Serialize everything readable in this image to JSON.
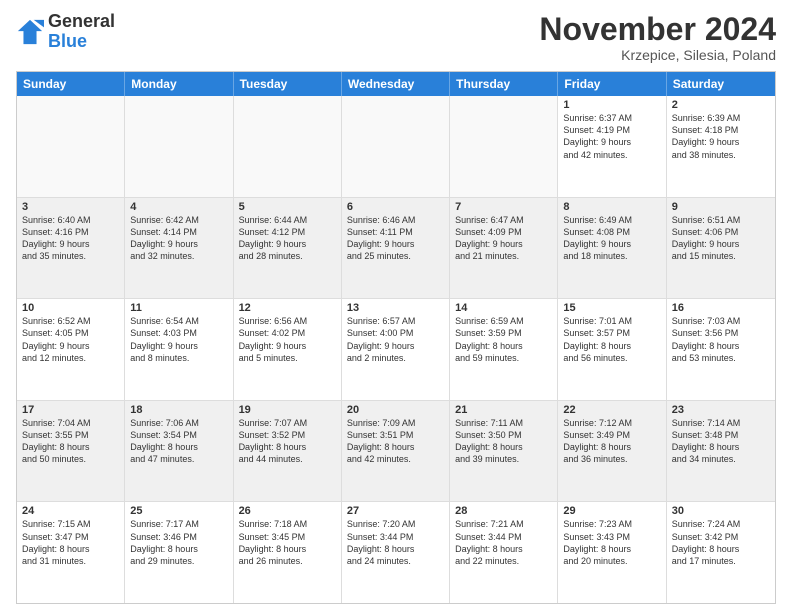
{
  "header": {
    "logo": {
      "general": "General",
      "blue": "Blue"
    },
    "title": "November 2024",
    "location": "Krzepice, Silesia, Poland"
  },
  "weekdays": [
    "Sunday",
    "Monday",
    "Tuesday",
    "Wednesday",
    "Thursday",
    "Friday",
    "Saturday"
  ],
  "rows": [
    [
      {
        "day": "",
        "info": "",
        "empty": true
      },
      {
        "day": "",
        "info": "",
        "empty": true
      },
      {
        "day": "",
        "info": "",
        "empty": true
      },
      {
        "day": "",
        "info": "",
        "empty": true
      },
      {
        "day": "",
        "info": "",
        "empty": true
      },
      {
        "day": "1",
        "info": "Sunrise: 6:37 AM\nSunset: 4:19 PM\nDaylight: 9 hours\nand 42 minutes.",
        "empty": false
      },
      {
        "day": "2",
        "info": "Sunrise: 6:39 AM\nSunset: 4:18 PM\nDaylight: 9 hours\nand 38 minutes.",
        "empty": false
      }
    ],
    [
      {
        "day": "3",
        "info": "Sunrise: 6:40 AM\nSunset: 4:16 PM\nDaylight: 9 hours\nand 35 minutes.",
        "empty": false
      },
      {
        "day": "4",
        "info": "Sunrise: 6:42 AM\nSunset: 4:14 PM\nDaylight: 9 hours\nand 32 minutes.",
        "empty": false
      },
      {
        "day": "5",
        "info": "Sunrise: 6:44 AM\nSunset: 4:12 PM\nDaylight: 9 hours\nand 28 minutes.",
        "empty": false
      },
      {
        "day": "6",
        "info": "Sunrise: 6:46 AM\nSunset: 4:11 PM\nDaylight: 9 hours\nand 25 minutes.",
        "empty": false
      },
      {
        "day": "7",
        "info": "Sunrise: 6:47 AM\nSunset: 4:09 PM\nDaylight: 9 hours\nand 21 minutes.",
        "empty": false
      },
      {
        "day": "8",
        "info": "Sunrise: 6:49 AM\nSunset: 4:08 PM\nDaylight: 9 hours\nand 18 minutes.",
        "empty": false
      },
      {
        "day": "9",
        "info": "Sunrise: 6:51 AM\nSunset: 4:06 PM\nDaylight: 9 hours\nand 15 minutes.",
        "empty": false
      }
    ],
    [
      {
        "day": "10",
        "info": "Sunrise: 6:52 AM\nSunset: 4:05 PM\nDaylight: 9 hours\nand 12 minutes.",
        "empty": false
      },
      {
        "day": "11",
        "info": "Sunrise: 6:54 AM\nSunset: 4:03 PM\nDaylight: 9 hours\nand 8 minutes.",
        "empty": false
      },
      {
        "day": "12",
        "info": "Sunrise: 6:56 AM\nSunset: 4:02 PM\nDaylight: 9 hours\nand 5 minutes.",
        "empty": false
      },
      {
        "day": "13",
        "info": "Sunrise: 6:57 AM\nSunset: 4:00 PM\nDaylight: 9 hours\nand 2 minutes.",
        "empty": false
      },
      {
        "day": "14",
        "info": "Sunrise: 6:59 AM\nSunset: 3:59 PM\nDaylight: 8 hours\nand 59 minutes.",
        "empty": false
      },
      {
        "day": "15",
        "info": "Sunrise: 7:01 AM\nSunset: 3:57 PM\nDaylight: 8 hours\nand 56 minutes.",
        "empty": false
      },
      {
        "day": "16",
        "info": "Sunrise: 7:03 AM\nSunset: 3:56 PM\nDaylight: 8 hours\nand 53 minutes.",
        "empty": false
      }
    ],
    [
      {
        "day": "17",
        "info": "Sunrise: 7:04 AM\nSunset: 3:55 PM\nDaylight: 8 hours\nand 50 minutes.",
        "empty": false
      },
      {
        "day": "18",
        "info": "Sunrise: 7:06 AM\nSunset: 3:54 PM\nDaylight: 8 hours\nand 47 minutes.",
        "empty": false
      },
      {
        "day": "19",
        "info": "Sunrise: 7:07 AM\nSunset: 3:52 PM\nDaylight: 8 hours\nand 44 minutes.",
        "empty": false
      },
      {
        "day": "20",
        "info": "Sunrise: 7:09 AM\nSunset: 3:51 PM\nDaylight: 8 hours\nand 42 minutes.",
        "empty": false
      },
      {
        "day": "21",
        "info": "Sunrise: 7:11 AM\nSunset: 3:50 PM\nDaylight: 8 hours\nand 39 minutes.",
        "empty": false
      },
      {
        "day": "22",
        "info": "Sunrise: 7:12 AM\nSunset: 3:49 PM\nDaylight: 8 hours\nand 36 minutes.",
        "empty": false
      },
      {
        "day": "23",
        "info": "Sunrise: 7:14 AM\nSunset: 3:48 PM\nDaylight: 8 hours\nand 34 minutes.",
        "empty": false
      }
    ],
    [
      {
        "day": "24",
        "info": "Sunrise: 7:15 AM\nSunset: 3:47 PM\nDaylight: 8 hours\nand 31 minutes.",
        "empty": false
      },
      {
        "day": "25",
        "info": "Sunrise: 7:17 AM\nSunset: 3:46 PM\nDaylight: 8 hours\nand 29 minutes.",
        "empty": false
      },
      {
        "day": "26",
        "info": "Sunrise: 7:18 AM\nSunset: 3:45 PM\nDaylight: 8 hours\nand 26 minutes.",
        "empty": false
      },
      {
        "day": "27",
        "info": "Sunrise: 7:20 AM\nSunset: 3:44 PM\nDaylight: 8 hours\nand 24 minutes.",
        "empty": false
      },
      {
        "day": "28",
        "info": "Sunrise: 7:21 AM\nSunset: 3:44 PM\nDaylight: 8 hours\nand 22 minutes.",
        "empty": false
      },
      {
        "day": "29",
        "info": "Sunrise: 7:23 AM\nSunset: 3:43 PM\nDaylight: 8 hours\nand 20 minutes.",
        "empty": false
      },
      {
        "day": "30",
        "info": "Sunrise: 7:24 AM\nSunset: 3:42 PM\nDaylight: 8 hours\nand 17 minutes.",
        "empty": false
      }
    ]
  ]
}
